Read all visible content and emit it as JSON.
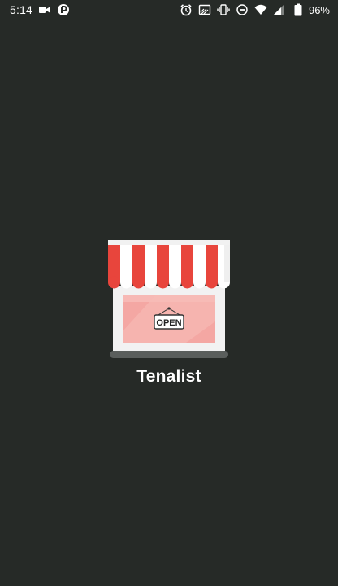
{
  "status_bar": {
    "time": "5:14",
    "battery_percent": "96%",
    "left_icons": [
      "video-camera-icon",
      "parking-icon"
    ],
    "right_icons": [
      "alarm-icon",
      "cast-icon",
      "vibrate-icon",
      "do-not-disturb-icon",
      "wifi-icon",
      "signal-icon",
      "battery-icon"
    ]
  },
  "splash": {
    "app_name": "Tenalist",
    "sign_text": "OPEN",
    "logo_icon": "store-icon"
  },
  "colors": {
    "background": "#262a27",
    "awning_red": "#e8453c",
    "awning_white": "#ffffff",
    "window_pink": "#f4a7a3",
    "store_wall": "#f2f2f2",
    "base_gray": "#5a5e5c"
  }
}
